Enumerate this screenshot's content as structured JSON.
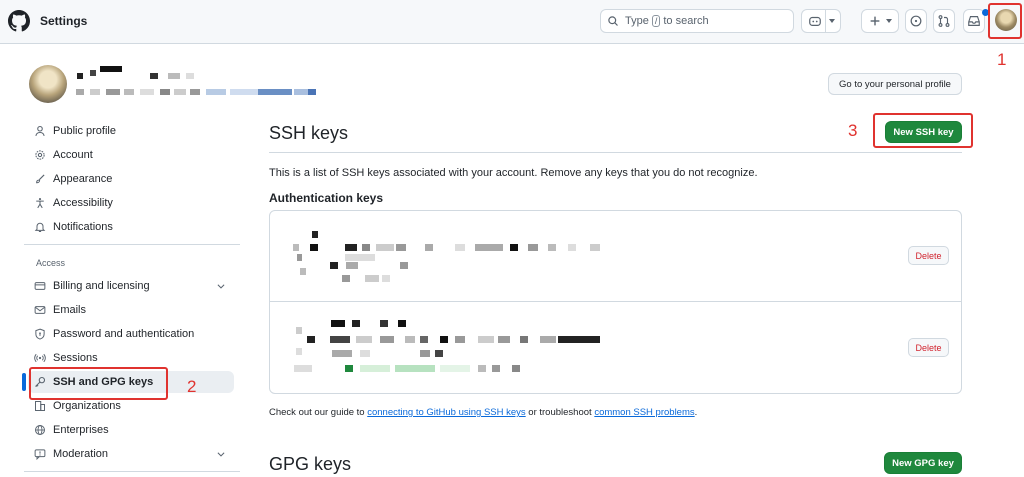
{
  "header": {
    "title": "Settings",
    "search_prefix": "Type",
    "search_key": "/",
    "search_suffix": "to search"
  },
  "annotations": [
    "1",
    "2",
    "3"
  ],
  "profile": {
    "personal_profile_button": "Go to your personal profile"
  },
  "sidebar": {
    "items_top": [
      {
        "label": "Public profile",
        "icon": "person-icon"
      },
      {
        "label": "Account",
        "icon": "gear-icon"
      },
      {
        "label": "Appearance",
        "icon": "paintbrush-icon"
      },
      {
        "label": "Accessibility",
        "icon": "accessibility-icon"
      },
      {
        "label": "Notifications",
        "icon": "bell-icon"
      }
    ],
    "access_heading": "Access",
    "items_access": [
      {
        "label": "Billing and licensing",
        "icon": "credit-card-icon",
        "expandable": true
      },
      {
        "label": "Emails",
        "icon": "mail-icon"
      },
      {
        "label": "Password and authentication",
        "icon": "shield-lock-icon"
      },
      {
        "label": "Sessions",
        "icon": "broadcast-icon"
      },
      {
        "label": "SSH and GPG keys",
        "icon": "key-icon",
        "active": true
      },
      {
        "label": "Organizations",
        "icon": "organization-icon"
      },
      {
        "label": "Enterprises",
        "icon": "globe-icon"
      },
      {
        "label": "Moderation",
        "icon": "report-icon",
        "expandable": true
      }
    ]
  },
  "main": {
    "ssh_title": "SSH keys",
    "new_ssh_button": "New SSH key",
    "description": "This is a list of SSH keys associated with your account. Remove any keys that you do not recognize.",
    "auth_heading": "Authentication keys",
    "delete_label": "Delete",
    "footer_prefix": "Check out our guide to",
    "footer_link1": "connecting to GitHub using SSH keys",
    "footer_middle": "or troubleshoot",
    "footer_link2": "common SSH problems",
    "footer_end": ".",
    "gpg_title": "GPG keys",
    "new_gpg_button": "New GPG key"
  },
  "colors": {
    "accent_blue": "#0969da",
    "green_button": "#1f883d",
    "annotation_red": "#e0332f",
    "danger_red": "#d1242f"
  }
}
